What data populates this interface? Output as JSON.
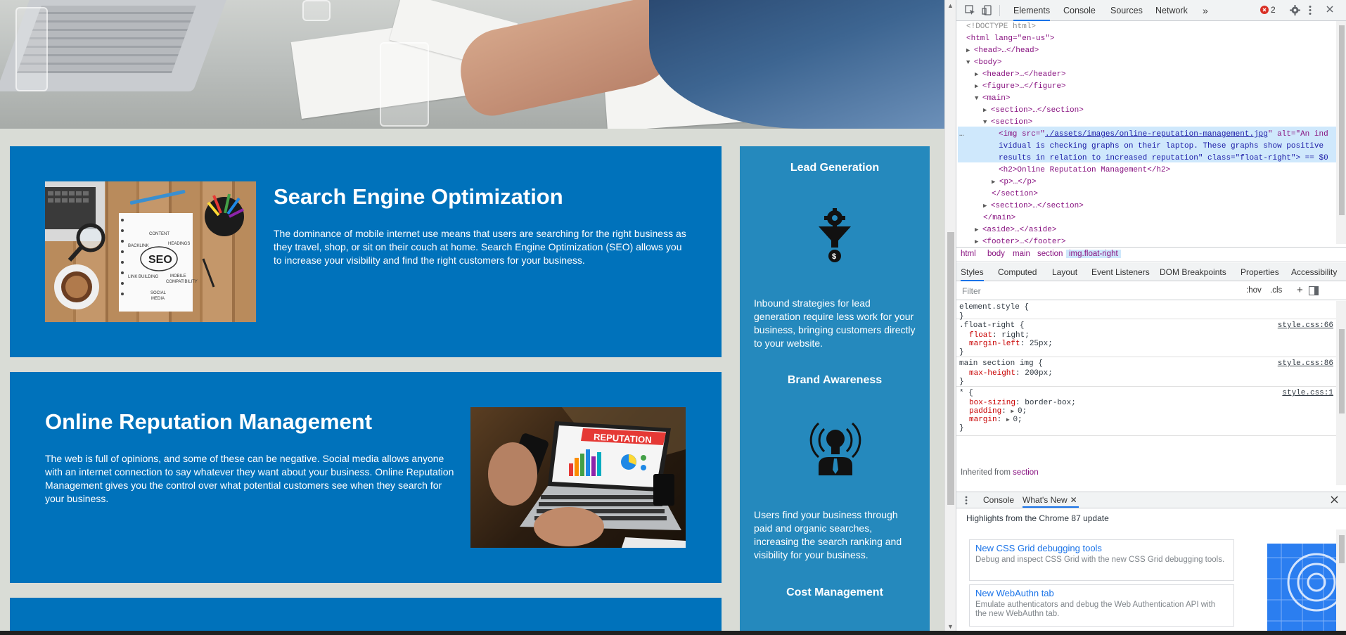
{
  "site": {
    "seo": {
      "title": "Search Engine Optimization",
      "body": "The dominance of mobile internet use means that users are searching for the right business as they travel, shop, or sit on their couch at home. Search Engine Optimization (SEO) allows you to increase your visibility and find the right customers for your business.",
      "image_words": [
        "CONTENT",
        "HEADINGS",
        "BACKLINK",
        "SEO",
        "LINK BUILDING",
        "MOBILE COMPATIBILITY",
        "SOCIAL MEDIA"
      ]
    },
    "orm": {
      "title": "Online Reputation Management",
      "body": "The web is full of opinions, and some of these can be negative. Social media allows anyone with an internet connection to say whatever they want about your business. Online Reputation Management gives you the control over what potential customers see when they search for your business.",
      "image_banner": "REPUTATION"
    },
    "aside": {
      "items": [
        {
          "title": "Lead Generation",
          "body": "Inbound strategies for lead generation require less work for your business, bringing customers directly to your website.",
          "icon": "funnel-gear-dollar-icon"
        },
        {
          "title": "Brand Awareness",
          "body": "Users find your business through paid and organic searches, increasing the search ranking and visibility for your business.",
          "icon": "lightbulb-person-icon"
        },
        {
          "title": "Cost Management",
          "body": "",
          "icon": ""
        }
      ]
    },
    "colors": {
      "card": "#0072bb",
      "aside": "#2589bd",
      "page": "#d9dcd6"
    }
  },
  "devtools": {
    "tabs": [
      "Elements",
      "Console",
      "Sources",
      "Network"
    ],
    "more_tabs": "»",
    "error_count": "2",
    "dom_lines": {
      "doctype": "<!DOCTYPE html>",
      "html_open": "<html lang=\"en-us\">",
      "head": "<head>…</head>",
      "body_open": "<body>",
      "header": "<header>…</header>",
      "figure": "<figure>…</figure>",
      "main_open": "<main>",
      "section1": "<section>…</section>",
      "section_open": "<section>",
      "img_1": "<img src=\"",
      "img_src": "./assets/images/online-reputation-management.jpg",
      "img_2": "\" alt=\"An ind",
      "img_3": "ividual is checking graphs on their laptop. These graphs show positive",
      "img_4": "results in relation to increased reputation\" class=\"float-right\"> == $0",
      "h2": "<h2>Online Reputation Management</h2>",
      "p": "<p>…</p>",
      "section_close": "</section>",
      "section3": "<section>…</section>",
      "main_close": "</main>",
      "aside": "<aside>…</aside>",
      "footer": "<footer>…</footer>",
      "dots": "…"
    },
    "breadcrumb": [
      "html",
      "body",
      "main",
      "section",
      "img.float-right"
    ],
    "style_tabs": [
      "Styles",
      "Computed",
      "Layout",
      "Event Listeners",
      "DOM Breakpoints",
      "Properties",
      "Accessibility"
    ],
    "filter_placeholder": "Filter",
    "hov": ":hov",
    "cls": ".cls",
    "plus": "+",
    "rules": {
      "r0_sel": "element.style {",
      "r0_close": "}",
      "r1_sel": ".float-right {",
      "r1_src": "style.css:66",
      "r1_p1n": "float",
      "r1_p1v": "right;",
      "r1_p2n": "margin-left",
      "r1_p2v": "25px;",
      "r1_close": "}",
      "r2_sel": "main section img {",
      "r2_src": "style.css:86",
      "r2_p1n": "max-height",
      "r2_p1v": "200px;",
      "r2_close": "}",
      "r3_sel": "* {",
      "r3_src": "style.css:1",
      "r3_p1n": "box-sizing",
      "r3_p1v": "border-box;",
      "r3_p2n": "padding",
      "r3_p2v": "0;",
      "r3_p3n": "margin",
      "r3_p3v": "0;",
      "r3_close": "}"
    },
    "inherited_label": "Inherited from",
    "inherited_from": "section",
    "drawer": {
      "console_tab": "Console",
      "whatsnew_tab": "What's New",
      "highlights": "Highlights from the Chrome 87 update",
      "cards": [
        {
          "title": "New CSS Grid debugging tools",
          "desc": "Debug and inspect CSS Grid with the new CSS Grid debugging tools."
        },
        {
          "title": "New WebAuthn tab",
          "desc": "Emulate authenticators and debug the Web Authentication API with the new WebAuthn tab."
        }
      ]
    },
    "colors": {
      "accent": "#1a73e8",
      "tag": "#881280",
      "attr": "#994500",
      "value": "#1a1aa6",
      "error": "#d93025"
    }
  }
}
